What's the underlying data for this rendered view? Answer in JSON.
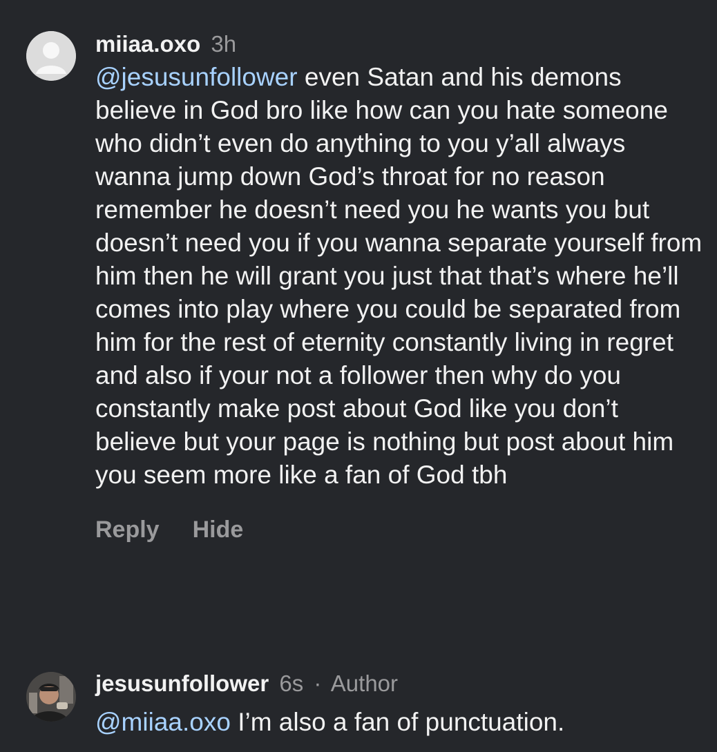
{
  "comments": [
    {
      "username": "miiaa.oxo",
      "time": "3h",
      "mention": "@jesusunfollower",
      "text": " even Satan and his demons believe in God bro like how can you hate someone who didn’t even do anything to you y’all always wanna jump down God’s throat for no reason remember he doesn’t need you he wants you but doesn’t need you if you wanna separate yourself from him then he will grant you just that that’s where he’ll comes into play where you could be separated from him for the rest of eternity constantly living in regret and also if your not a follower then why do you constantly make post about God like you don’t believe but your page is nothing but post about him you seem more like a fan of God tbh",
      "reply_label": "Reply",
      "hide_label": "Hide",
      "avatar_icon": "default-avatar-icon"
    },
    {
      "username": "jesusunfollower",
      "time": "6s",
      "separator": "·",
      "badge": "Author",
      "mention": "@miiaa.oxo",
      "text": " I’m also a fan of punctuation.",
      "avatar_icon": "user-photo-avatar"
    }
  ],
  "colors": {
    "background": "#25272b",
    "text": "#f2f2f2",
    "muted": "#9a9a9c",
    "mention": "#a8d2ff"
  }
}
